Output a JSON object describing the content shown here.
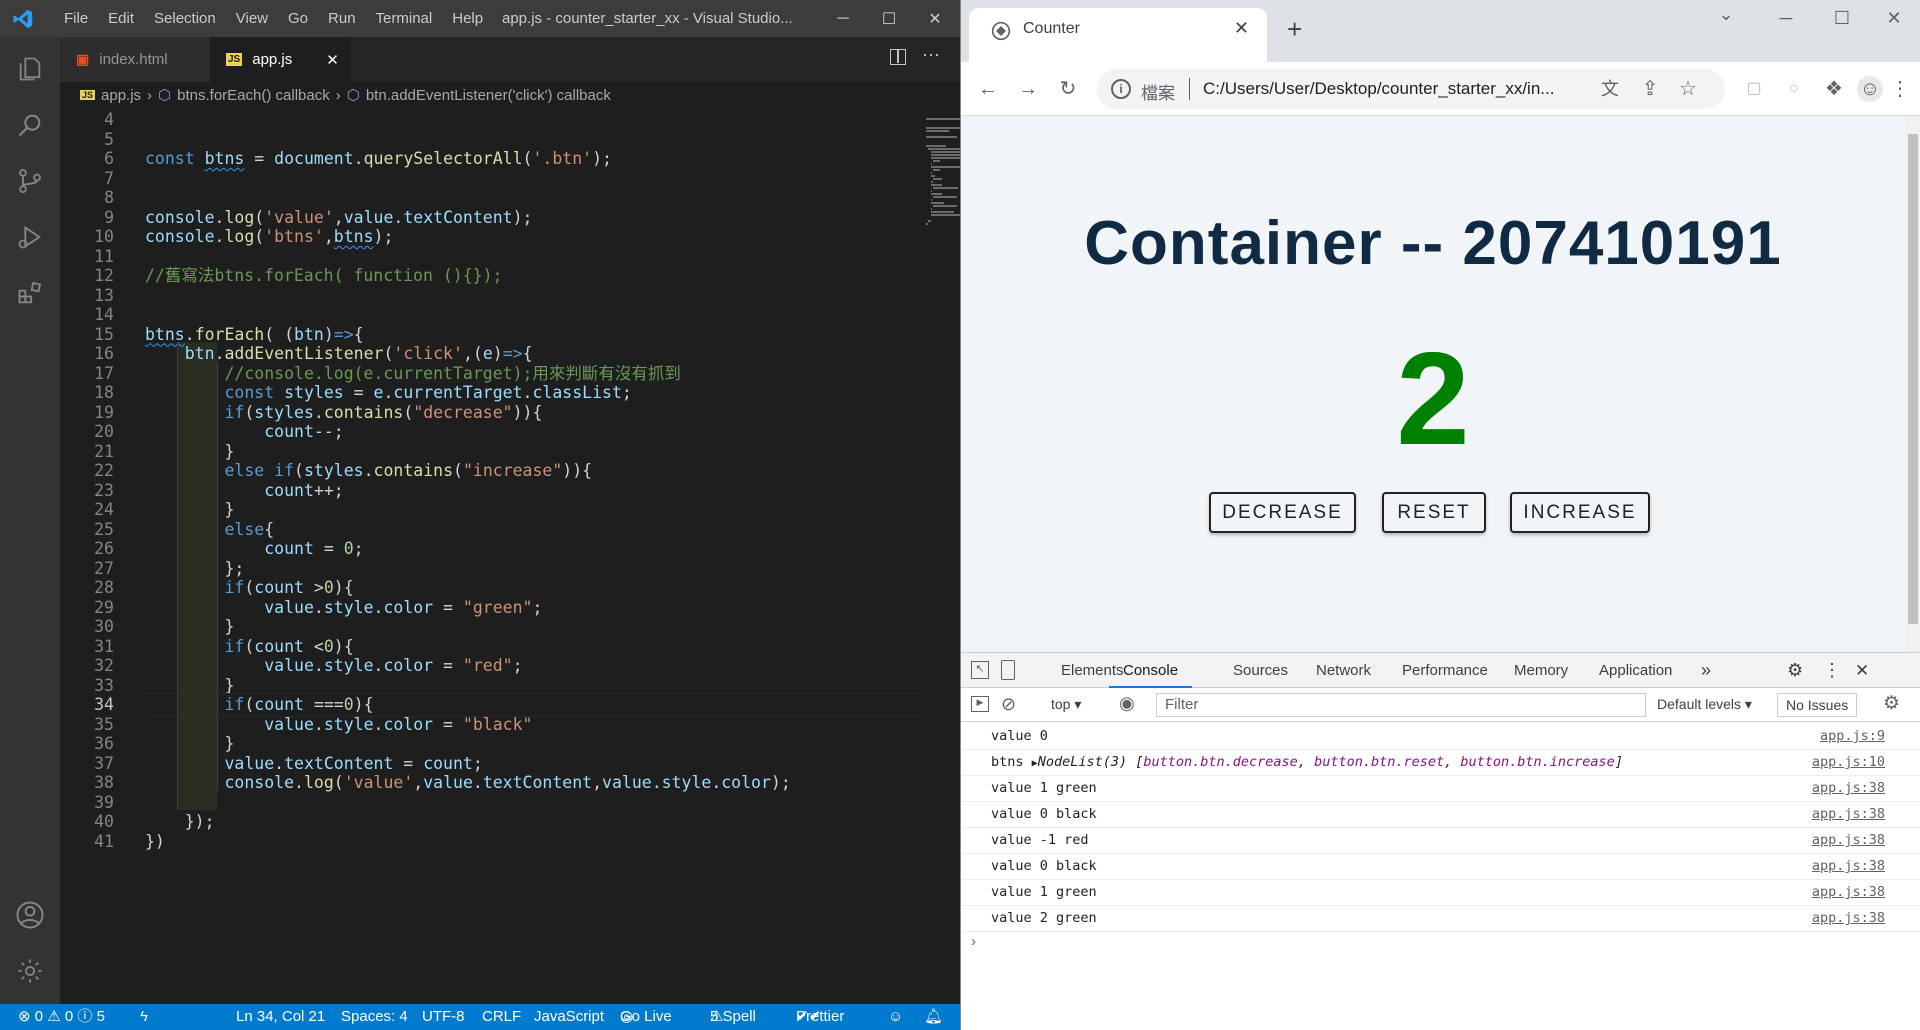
{
  "vscode": {
    "menu": [
      "File",
      "Edit",
      "Selection",
      "View",
      "Go",
      "Run",
      "Terminal",
      "Help"
    ],
    "window_title": "app.js - counter_starter_xx - Visual Studio...",
    "tabs": [
      {
        "label": "index.html"
      },
      {
        "label": "app.js"
      }
    ],
    "breadcrumb": [
      "app.js",
      "btns.forEach() callback",
      "btn.addEventListener('click') callback"
    ],
    "status": {
      "errors": "0",
      "warnings": "0",
      "info": "5",
      "position": "Ln 34, Col 21",
      "spaces": "Spaces: 4",
      "encoding": "UTF-8",
      "eol": "CRLF",
      "language": "JavaScript",
      "golive": "Go Live",
      "spell": "5 Spell",
      "prettier": "Prettier"
    },
    "code_lines": [
      {
        "n": "4",
        "text": ""
      },
      {
        "n": "5",
        "text": ""
      },
      {
        "n": "6",
        "text": "const btns = document.querySelectorAll('.btn');"
      },
      {
        "n": "7",
        "text": ""
      },
      {
        "n": "8",
        "text": ""
      },
      {
        "n": "9",
        "text": "console.log('value',value.textContent);"
      },
      {
        "n": "10",
        "text": "console.log('btns',btns);"
      },
      {
        "n": "11",
        "text": ""
      },
      {
        "n": "12",
        "text": "//舊寫法btns.forEach( function (){});"
      },
      {
        "n": "13",
        "text": ""
      },
      {
        "n": "14",
        "text": ""
      },
      {
        "n": "15",
        "text": "btns.forEach( (btn)=>{"
      },
      {
        "n": "16",
        "text": "    btn.addEventListener('click',(e)=>{"
      },
      {
        "n": "17",
        "text": "        //console.log(e.currentTarget);用來判斷有沒有抓到"
      },
      {
        "n": "18",
        "text": "        const styles = e.currentTarget.classList;"
      },
      {
        "n": "19",
        "text": "        if(styles.contains(\"decrease\")){"
      },
      {
        "n": "20",
        "text": "            count--;"
      },
      {
        "n": "21",
        "text": "        }"
      },
      {
        "n": "22",
        "text": "        else if(styles.contains(\"increase\")){"
      },
      {
        "n": "23",
        "text": "            count++;"
      },
      {
        "n": "24",
        "text": "        }"
      },
      {
        "n": "25",
        "text": "        else{"
      },
      {
        "n": "26",
        "text": "            count = 0;"
      },
      {
        "n": "27",
        "text": "        };"
      },
      {
        "n": "28",
        "text": "        if(count >0){"
      },
      {
        "n": "29",
        "text": "            value.style.color = \"green\";"
      },
      {
        "n": "30",
        "text": "        }"
      },
      {
        "n": "31",
        "text": "        if(count <0){"
      },
      {
        "n": "32",
        "text": "            value.style.color = \"red\";"
      },
      {
        "n": "33",
        "text": "        }"
      },
      {
        "n": "34",
        "text": "        if(count ===0){"
      },
      {
        "n": "35",
        "text": "            value.style.color = \"black\""
      },
      {
        "n": "36",
        "text": "        }"
      },
      {
        "n": "37",
        "text": "        value.textContent = count;"
      },
      {
        "n": "38",
        "text": "        console.log('value',value.textContent,value.style.color);"
      },
      {
        "n": "39",
        "text": ""
      },
      {
        "n": "40",
        "text": "    });"
      },
      {
        "n": "41",
        "text": "})"
      }
    ]
  },
  "chrome": {
    "tab_title": "Counter",
    "address_scheme": "檔案",
    "address_url": "C:/Users/User/Desktop/counter_starter_xx/in...",
    "page": {
      "heading": "Container -- 207410191",
      "count": "2",
      "count_color": "#008000",
      "buttons": [
        "DECREASE",
        "RESET",
        "INCREASE"
      ]
    },
    "devtools": {
      "tabs": [
        "Elements",
        "Console",
        "Sources",
        "Network",
        "Performance",
        "Memory",
        "Application"
      ],
      "active_tab": "Console",
      "context": "top",
      "filter_placeholder": "Filter",
      "levels": "Default levels",
      "issues": "No Issues",
      "console": [
        {
          "msg": "value 0",
          "src": "app.js:9"
        },
        {
          "msg": "btns",
          "nodelist": "NodeList(3)",
          "items": [
            "button.btn.decrease",
            "button.btn.reset",
            "button.btn.increase"
          ],
          "src": "app.js:10"
        },
        {
          "msg": "value 1 green",
          "src": "app.js:38"
        },
        {
          "msg": "value 0 black",
          "src": "app.js:38"
        },
        {
          "msg": "value -1 red",
          "src": "app.js:38"
        },
        {
          "msg": "value 0 black",
          "src": "app.js:38"
        },
        {
          "msg": "value 1 green",
          "src": "app.js:38"
        },
        {
          "msg": "value 2 green",
          "src": "app.js:38"
        }
      ]
    }
  }
}
